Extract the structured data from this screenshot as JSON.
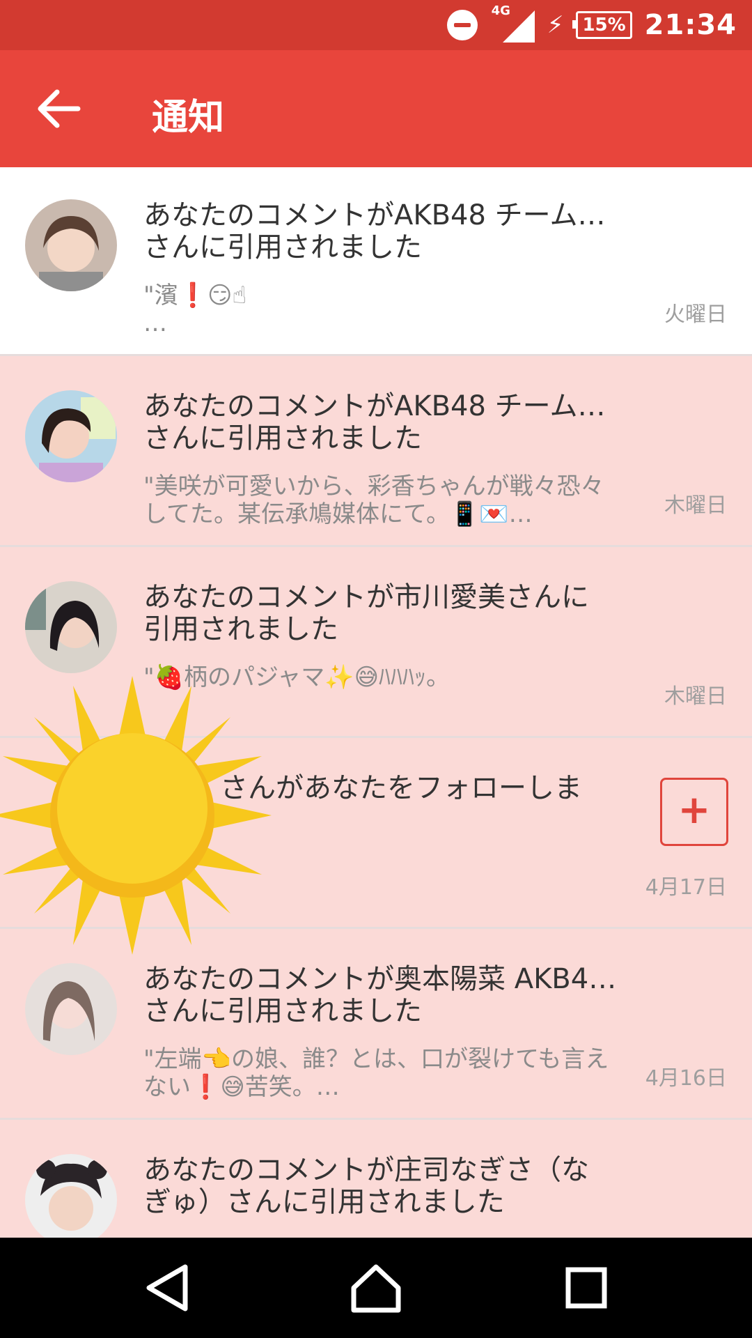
{
  "status_bar": {
    "network": "4G",
    "battery": "15%",
    "time": "21:34",
    "icons": [
      "do-not-disturb-icon",
      "signal-icon",
      "charging-icon",
      "battery-icon"
    ]
  },
  "app_bar": {
    "title": "通知",
    "back_icon": "arrow-left-icon"
  },
  "notifications": [
    {
      "title": "あなたのコメントがAKB48 チーム…\nさんに引用されました",
      "preview": "\"濱❗😏☝\n…",
      "date": "火曜日",
      "read": true
    },
    {
      "title": "あなたのコメントがAKB48 チーム…\nさんに引用されました",
      "preview": "\"美咲が可愛いから、彩香ちゃんが戦々恐々\nしてた。某伝承鳩媒体にて。📱💌…",
      "date": "木曜日",
      "read": false
    },
    {
      "title": "あなたのコメントが市川愛美さんに\n引用されました",
      "preview": "\"🍓柄のパジャマ✨😅ﾊﾊﾊｯ。",
      "date": "木曜日",
      "read": false
    },
    {
      "title": "さんがあなたをフォローしま",
      "preview": "",
      "date": "4月17日",
      "read": false,
      "follow_button": "+"
    },
    {
      "title": "あなたのコメントが奥本陽菜 AKB4…\nさんに引用されました",
      "preview": "\"左端👈の娘、誰？とは、口が裂けても言え\nない❗😅苦笑。…",
      "date": "4月16日",
      "read": false
    },
    {
      "title": "あなたのコメントが庄司なぎさ（な\nぎゅ）さんに引用されました",
      "preview": "",
      "date": "",
      "read": false
    }
  ],
  "overlay": {
    "icon": "sun-icon"
  },
  "nav_bar": {
    "icons": [
      "back-triangle-icon",
      "home-icon",
      "recents-icon"
    ]
  },
  "colors": {
    "status_bar": "#d23a30",
    "app_bar": "#e8453c",
    "unread_bg": "#fbdad7",
    "read_bg": "#ffffff",
    "accent": "#e0453c"
  }
}
